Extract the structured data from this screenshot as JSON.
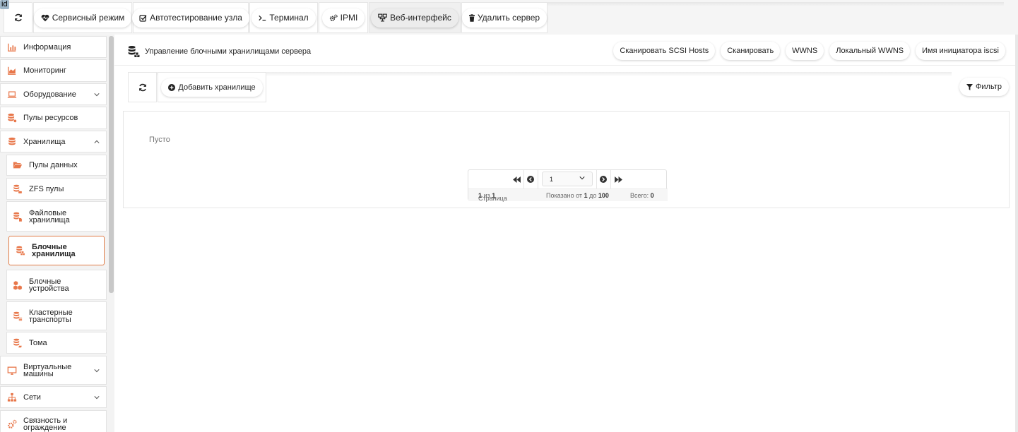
{
  "badge": "id",
  "toolbar": {
    "service_mode": "Сервисный режим",
    "autotest": "Автотестирование узла",
    "terminal": "Терминал",
    "ipmi": "IPMI",
    "web": "Веб-интерфейс",
    "delete": "Удалить сервер"
  },
  "sidebar": {
    "info": "Информация",
    "monitoring": "Мониторинг",
    "hardware": "Оборудование",
    "resource_pools": "Пулы ресурсов",
    "storage": "Хранилища",
    "data_pools": "Пулы данных",
    "zfs_pools": "ZFS пулы",
    "file_storage": [
      "Файловые",
      "хранилища"
    ],
    "block_storage": [
      "Блочные",
      "хранилища"
    ],
    "block_devices": [
      "Блочные",
      "устройства"
    ],
    "cluster_transports": [
      "Кластерные",
      "транспорты"
    ],
    "volumes": "Тома",
    "vms": [
      "Виртуальные",
      "машины"
    ],
    "networks": "Сети",
    "connectivity": [
      "Связность и",
      "ограждение"
    ]
  },
  "page": {
    "title": "Управление блочными хранилищами сервера",
    "actions": {
      "scan_scsi": "Сканировать SCSI Hosts",
      "scan": "Сканировать",
      "wwns": "WWNS",
      "local_wwns": "Локальный WWNS",
      "iscsi_name": "Имя инициатора iscsi"
    },
    "add_storage": "Добавить хранилище",
    "filter": "Фильтр",
    "empty": "Пусто"
  },
  "pager": {
    "current_page": "1",
    "page_word": "Страница",
    "page_num": "1",
    "of_word": "из",
    "page_total": "1",
    "shown_word": "Показано от",
    "from": "1",
    "to_word": "до",
    "to": "100",
    "total_word": "Всего:",
    "total": "0"
  },
  "colors": {
    "accent": "#e07b45",
    "icon_orange": "#e8774a"
  }
}
